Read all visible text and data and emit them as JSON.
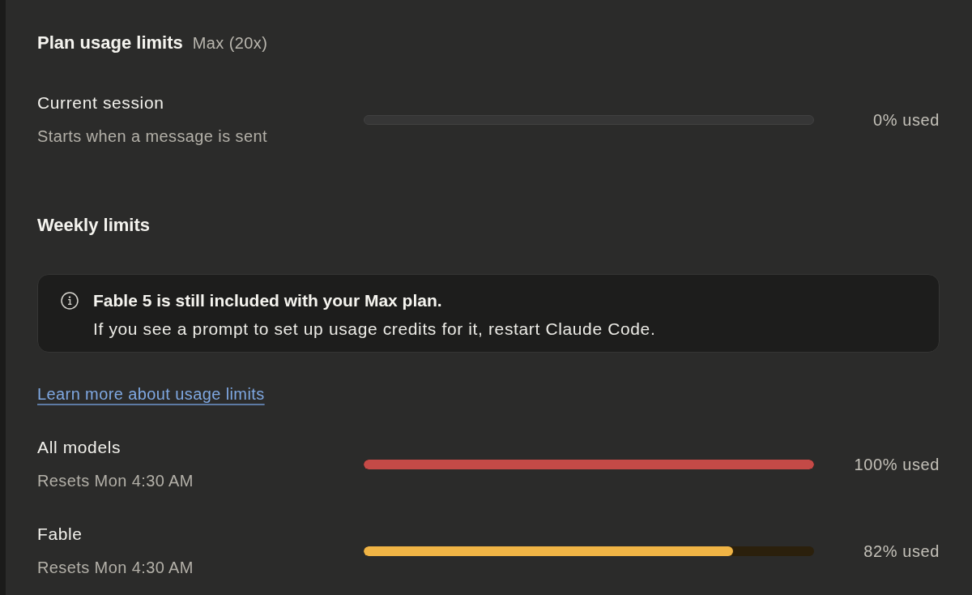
{
  "header": {
    "title": "Plan usage limits",
    "plan": "Max (20x)"
  },
  "session": {
    "name": "Current session",
    "note": "Starts when a message is sent",
    "level": 0,
    "reading": "0% used"
  },
  "weekly": {
    "title": "Weekly limits",
    "notice": {
      "headline": "Fable 5 is still included with your Max plan.",
      "body": "If you see a prompt to set up usage credits for it, restart Claude Code."
    },
    "link": "Learn more about usage limits",
    "limits": [
      {
        "name": "All models",
        "note": "Resets Mon 4:30 AM",
        "level": 1,
        "reading": "100% used",
        "color": "#c44a47"
      },
      {
        "name": "Fable",
        "note": "Resets Mon 4:30 AM",
        "level": 0.82,
        "reading": "82% used",
        "color": "#f0b445"
      }
    ]
  }
}
